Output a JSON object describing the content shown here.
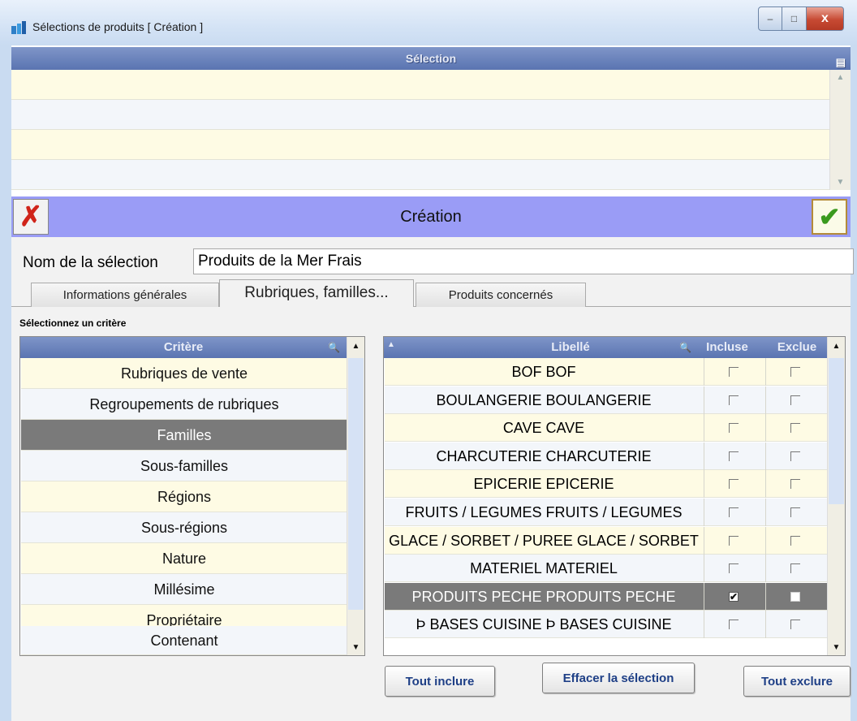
{
  "window": {
    "title": "Sélections de produits  [ Création ]",
    "minimize": "–",
    "maximize": "□",
    "close": "x"
  },
  "selection_table": {
    "header": "Sélection",
    "rows": [
      "",
      "",
      "",
      ""
    ]
  },
  "creation_bar": {
    "title": "Création",
    "cancel_glyph": "✗",
    "ok_glyph": "✔"
  },
  "form": {
    "name_label": "Nom de la sélection",
    "name_value": "Produits de la Mer Frais"
  },
  "tabs": [
    {
      "label": "Informations générales",
      "active": false
    },
    {
      "label": "Rubriques, familles...",
      "active": true
    },
    {
      "label": "Produits concernés",
      "active": false
    }
  ],
  "criteria": {
    "caption": "Sélectionnez un critère",
    "header": "Critère",
    "items": [
      {
        "label": "Rubriques de vente",
        "selected": false
      },
      {
        "label": "Regroupements de rubriques",
        "selected": false
      },
      {
        "label": "Familles",
        "selected": true
      },
      {
        "label": "Sous-familles",
        "selected": false
      },
      {
        "label": "Régions",
        "selected": false
      },
      {
        "label": "Sous-régions",
        "selected": false
      },
      {
        "label": "Nature",
        "selected": false
      },
      {
        "label": "Millésime",
        "selected": false
      },
      {
        "label": "Propriétaire",
        "selected": false
      },
      {
        "label": "Contenant",
        "selected": false
      }
    ]
  },
  "families": {
    "headers": {
      "libelle": "Libellé",
      "incluse": "Incluse",
      "exclue": "Exclue"
    },
    "rows": [
      {
        "libelle": "BOF BOF",
        "incluse": false,
        "exclue": false,
        "selected": false
      },
      {
        "libelle": "BOULANGERIE BOULANGERIE",
        "incluse": false,
        "exclue": false,
        "selected": false
      },
      {
        "libelle": "CAVE CAVE",
        "incluse": false,
        "exclue": false,
        "selected": false
      },
      {
        "libelle": "CHARCUTERIE CHARCUTERIE",
        "incluse": false,
        "exclue": false,
        "selected": false
      },
      {
        "libelle": "EPICERIE EPICERIE",
        "incluse": false,
        "exclue": false,
        "selected": false
      },
      {
        "libelle": "FRUITS / LEGUMES FRUITS / LEGUMES",
        "incluse": false,
        "exclue": false,
        "selected": false
      },
      {
        "libelle": "GLACE / SORBET / PUREE GLACE / SORBET",
        "incluse": false,
        "exclue": false,
        "selected": false
      },
      {
        "libelle": "MATERIEL MATERIEL",
        "incluse": false,
        "exclue": false,
        "selected": false
      },
      {
        "libelle": "PRODUITS PECHE PRODUITS PECHE",
        "incluse": true,
        "exclue": false,
        "selected": true
      },
      {
        "libelle": "Þ BASES CUISINE Þ BASES CUISINE",
        "incluse": false,
        "exclue": false,
        "selected": false
      }
    ]
  },
  "buttons": {
    "include_all": "Tout inclure",
    "clear_selection": "Effacer la sélection",
    "exclude_all": "Tout exclure"
  },
  "colors": {
    "header_blue": "#5a74b1",
    "creation_bar": "#9a9cf6",
    "row_odd": "#fefbe4",
    "row_even": "#f3f6fa",
    "row_selected": "#7a7a7a",
    "button_text": "#1e3f86"
  }
}
